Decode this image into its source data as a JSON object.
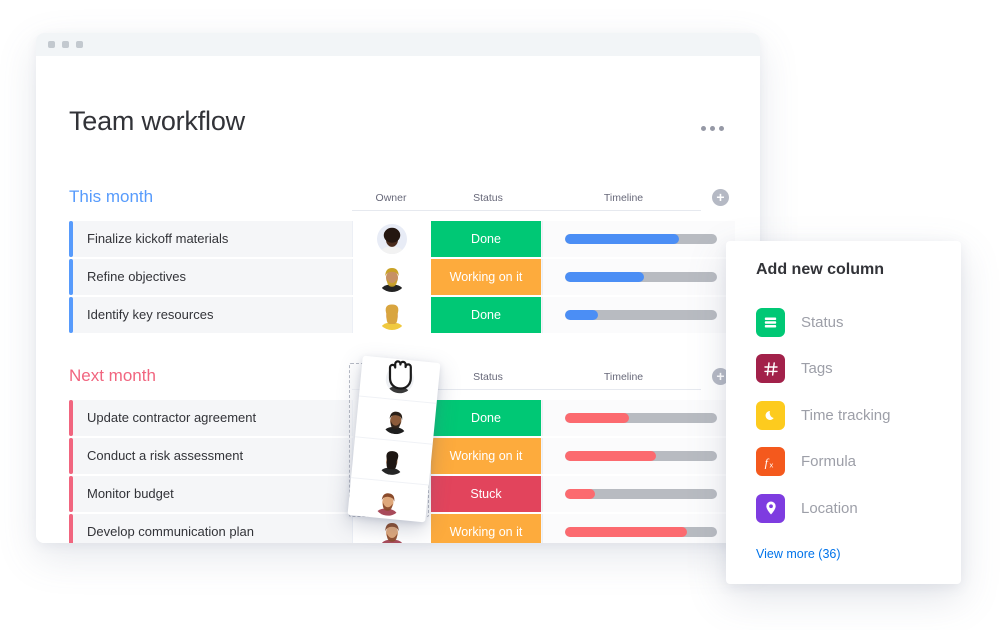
{
  "window": {
    "traffic_lights": [
      "dot-1",
      "dot-2",
      "dot-3"
    ],
    "board_title": "Team workflow",
    "overflow_menu": "..."
  },
  "columns": {
    "owner": "Owner",
    "status": "Status",
    "timeline": "Timeline",
    "add_column_icon": "plus-icon"
  },
  "groups": [
    {
      "id": "this-month",
      "title": "This month",
      "color": "#579bfc",
      "rows": [
        {
          "name": "Finalize kickoff materials",
          "owner": "avatar-woman-dark-hair",
          "status": "Done",
          "status_color": "#00c875",
          "progress": 75
        },
        {
          "name": "Refine objectives",
          "owner": "avatar-man-beard",
          "status": "Working on it",
          "status_color": "#fdab3d",
          "progress": 52
        },
        {
          "name": "Identify key resources",
          "owner": "avatar-woman-blonde",
          "status": "Done",
          "status_color": "#00c875",
          "progress": 22
        }
      ]
    },
    {
      "id": "next-month",
      "title": "Next month",
      "color": "#f1657f",
      "rows": [
        {
          "name": "Update contractor agreement",
          "owner": "avatar-man-short-hair",
          "status": "Done",
          "status_color": "#00c875",
          "progress": 42
        },
        {
          "name": "Conduct a risk assessment",
          "owner": "avatar-man-bald-beard",
          "status": "Working on it",
          "status_color": "#fdab3d",
          "progress": 60
        },
        {
          "name": "Monitor budget",
          "owner": "avatar-woman-dark",
          "status": "Stuck",
          "status_color": "#e2445c",
          "progress": 20
        },
        {
          "name": "Develop communication plan",
          "owner": "avatar-man-red-beard",
          "status": "Working on it",
          "status_color": "#fdab3d",
          "progress": 80
        }
      ]
    }
  ],
  "drag": {
    "column_being_dragged": "Owner",
    "cursor": "grab-hand-cursor",
    "avatars": [
      "avatar-man-short-hair",
      "avatar-man-bald-beard",
      "avatar-woman-dark",
      "avatar-man-red-beard"
    ]
  },
  "panel": {
    "title": "Add new column",
    "items": [
      {
        "label": "Status",
        "icon": "status-bars-icon",
        "color": "#00c875"
      },
      {
        "label": "Tags",
        "icon": "hash-icon",
        "color": "#a2214a"
      },
      {
        "label": "Time tracking",
        "icon": "moon-icon",
        "color": "#fdcb1e"
      },
      {
        "label": "Formula",
        "icon": "fx-icon",
        "color": "#f4591d"
      },
      {
        "label": "Location",
        "icon": "pin-icon",
        "color": "#7e3ce0"
      }
    ],
    "view_more": "View more (36)",
    "view_more_color": "#0073ea"
  }
}
